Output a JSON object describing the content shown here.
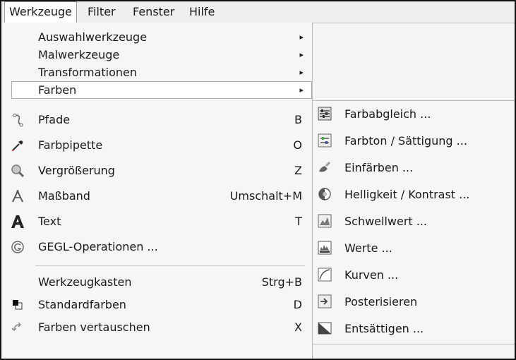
{
  "menubar": {
    "items": [
      {
        "label": "Werkzeuge"
      },
      {
        "label": "Filter"
      },
      {
        "label": "Fenster"
      },
      {
        "label": "Hilfe"
      }
    ]
  },
  "tools_menu": {
    "items": [
      {
        "label": "Auswahlwerkzeuge",
        "submenu": "▸"
      },
      {
        "label": "Malwerkzeuge",
        "submenu": "▸"
      },
      {
        "label": "Transformationen",
        "submenu": "▸"
      },
      {
        "label": "Farben",
        "submenu": "▸"
      },
      {
        "label": "Pfade",
        "shortcut": "B",
        "icon": "paths-icon"
      },
      {
        "label": "Farbpipette",
        "shortcut": "O",
        "icon": "color-picker-icon"
      },
      {
        "label": "Vergrößerung",
        "shortcut": "Z",
        "icon": "zoom-icon"
      },
      {
        "label": "Maßband",
        "shortcut": "Umschalt+M",
        "icon": "measure-icon"
      },
      {
        "label": "Text",
        "shortcut": "T",
        "icon": "text-icon"
      },
      {
        "label": "GEGL-Operationen ...",
        "icon": "gegl-icon"
      },
      {
        "label": "Werkzeugkasten",
        "shortcut": "Strg+B"
      },
      {
        "label": "Standardfarben",
        "shortcut": "D",
        "icon": "default-colors-icon"
      },
      {
        "label": "Farben vertauschen",
        "shortcut": "X",
        "icon": "swap-colors-icon"
      }
    ]
  },
  "colors_submenu": {
    "items": [
      {
        "label": "Farbabgleich ...",
        "icon": "color-balance-icon"
      },
      {
        "label": "Farbton / Sättigung ...",
        "icon": "hue-saturation-icon"
      },
      {
        "label": "Einfärben ...",
        "icon": "colorize-icon"
      },
      {
        "label": "Helligkeit / Kontrast ...",
        "icon": "brightness-contrast-icon"
      },
      {
        "label": "Schwellwert ...",
        "icon": "threshold-icon"
      },
      {
        "label": "Werte ...",
        "icon": "levels-icon"
      },
      {
        "label": "Kurven ...",
        "icon": "curves-icon"
      },
      {
        "label": "Posterisieren",
        "icon": "posterize-icon"
      },
      {
        "label": "Entsättigen ...",
        "icon": "desaturate-icon"
      }
    ]
  }
}
